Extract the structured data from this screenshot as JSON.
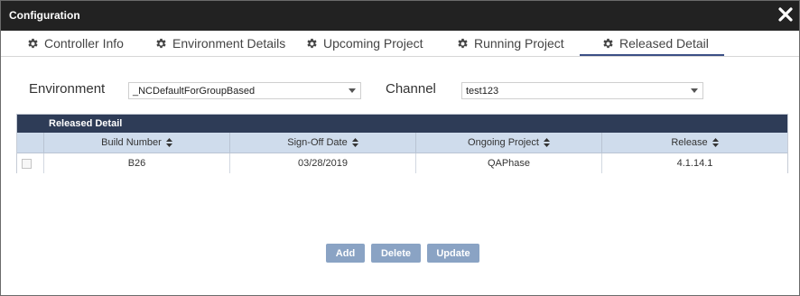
{
  "window": {
    "title": "Configuration"
  },
  "tabs": [
    {
      "label": "Controller Info"
    },
    {
      "label": "Environment Details"
    },
    {
      "label": "Upcoming Project"
    },
    {
      "label": "Running Project"
    },
    {
      "label": "Released Detail",
      "active": true
    }
  ],
  "filters": {
    "environment_label": "Environment",
    "environment_value": "_NCDefaultForGroupBased",
    "channel_label": "Channel",
    "channel_value": "test123"
  },
  "grid": {
    "caption": "Released Detail",
    "columns": [
      "Build Number",
      "Sign-Off Date",
      "Ongoing Project",
      "Release"
    ],
    "rows": [
      {
        "build_number": "B26",
        "sign_off_date": "03/28/2019",
        "ongoing_project": "QAPhase",
        "release": "4.1.14.1"
      }
    ]
  },
  "buttons": {
    "add": "Add",
    "delete": "Delete",
    "update": "Update"
  },
  "colors": {
    "titlebar": "#222222",
    "grid_caption": "#2e3c57",
    "grid_header": "#cfdcec",
    "button": "#8aa3c4",
    "active_tab_underline": "#3b4f86"
  }
}
